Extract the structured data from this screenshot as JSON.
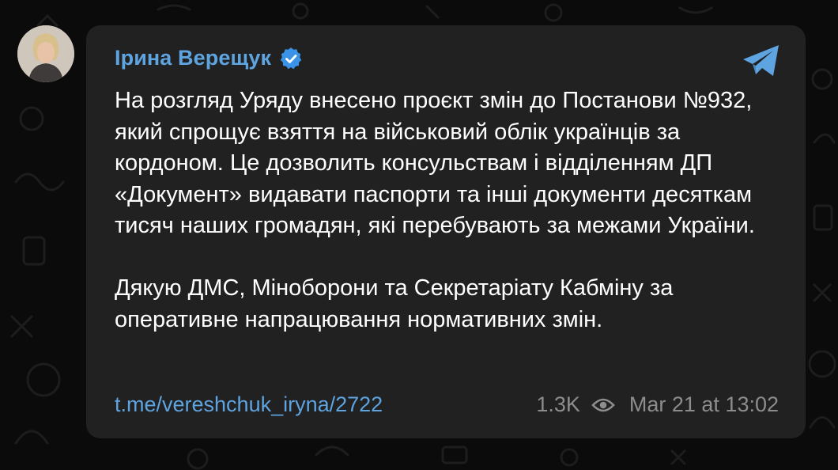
{
  "post": {
    "author": "Ірина Верещук",
    "paragraph1": "На розгляд Уряду внесено проєкт змін до Постанови №932, який спрощує взяття на військовий облік українців за кордоном. Це дозволить консульствам і відділенням ДП «Документ» видавати паспорти та інші документи десяткам тисяч наших громадян, які перебувають за межами України.",
    "paragraph2": "Дякую ДМС, Міноборони та Секретаріату Кабміну за оперативне напрацювання нормативних змін.",
    "link": "t.me/vereshchuk_iryna/2722",
    "views": "1.3K",
    "timestamp": "Mar 21 at 13:02"
  },
  "icons": {
    "verified": "verified-badge-icon",
    "share": "telegram-send-icon",
    "views": "eye-icon"
  },
  "colors": {
    "background": "#0b0b0b",
    "bubble": "#212121",
    "accent": "#5ea4e0",
    "text": "#ffffff",
    "muted": "#8d8d8d"
  }
}
